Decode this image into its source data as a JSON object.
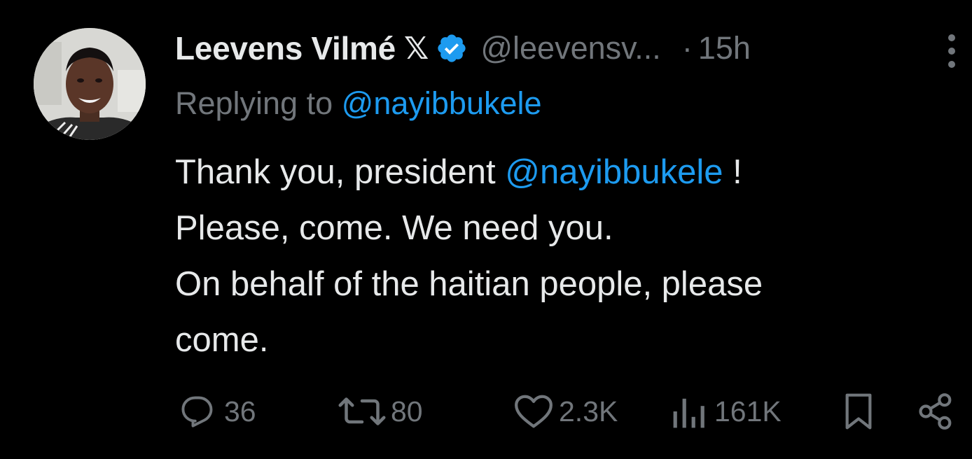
{
  "tweet": {
    "author": {
      "display_name": "Leevens Vilmé",
      "x_badge": "𝕏",
      "handle": "@leevensv...",
      "separator": "·",
      "time": "15h"
    },
    "reply_prefix": "Replying to",
    "reply_to": "@nayibbukele",
    "body": {
      "line1_a": "Thank you, president ",
      "line1_mention": "@nayibbukele",
      "line1_b": " !",
      "line2": "Please, come. We need you.",
      "line3": "On behalf of the haitian people, please",
      "line4": "come."
    },
    "actions": {
      "replies": "36",
      "reposts": "80",
      "likes": "2.3K",
      "views": "161K"
    }
  },
  "colors": {
    "background": "#000000",
    "text": "#e7e9ea",
    "secondary": "#71767b",
    "accent": "#1d9bf0"
  },
  "icons": [
    "avatar",
    "x-badge-icon",
    "verified-icon",
    "more-icon",
    "reply-icon",
    "repost-icon",
    "like-icon",
    "views-icon",
    "bookmark-icon",
    "share-icon"
  ]
}
